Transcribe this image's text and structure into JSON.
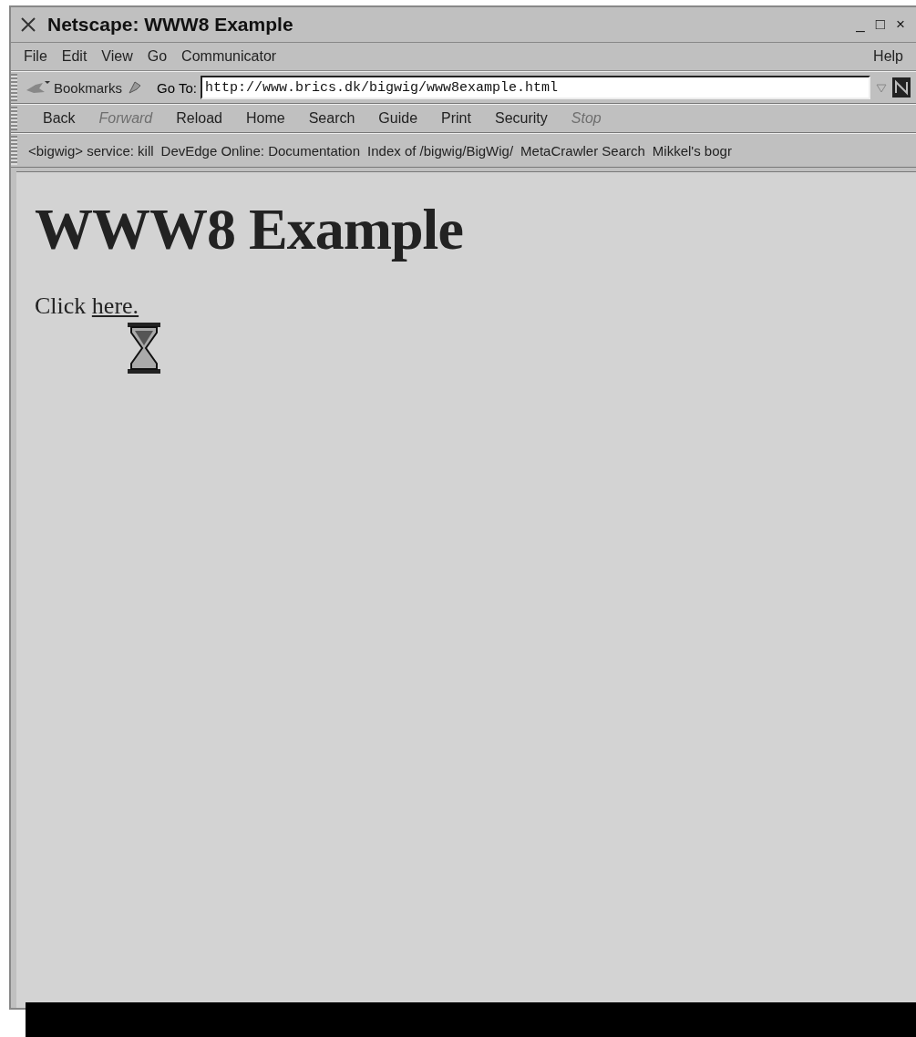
{
  "window": {
    "title": "Netscape: WWW8 Example",
    "controls": [
      "_",
      "□",
      "×"
    ]
  },
  "menu": [
    {
      "label": "File"
    },
    {
      "label": "Edit"
    },
    {
      "label": "View"
    },
    {
      "label": "Go"
    },
    {
      "label": "Communicator"
    }
  ],
  "help_menu": "Help",
  "location_bar": {
    "bookmarks_label": "Bookmarks",
    "goto_label": "Go To:",
    "url": "http://www.brics.dk/bigwig/www8example.html"
  },
  "nav_toolbar": [
    {
      "label": "Back",
      "disabled": false
    },
    {
      "label": "Forward",
      "disabled": true
    },
    {
      "label": "Reload",
      "disabled": false
    },
    {
      "label": "Home",
      "disabled": false
    },
    {
      "label": "Search",
      "disabled": false
    },
    {
      "label": "Guide",
      "disabled": false
    },
    {
      "label": "Print",
      "disabled": false
    },
    {
      "label": "Security",
      "disabled": false
    },
    {
      "label": "Stop",
      "disabled": true
    }
  ],
  "personal_toolbar": [
    "<bigwig> service: kill",
    "DevEdge Online: Documentation",
    "Index of /bigwig/BigWig/",
    "MetaCrawler Search",
    "Mikkel's bogr"
  ],
  "page": {
    "heading": "WWW8 Example",
    "text": "Click",
    "link": "here."
  }
}
